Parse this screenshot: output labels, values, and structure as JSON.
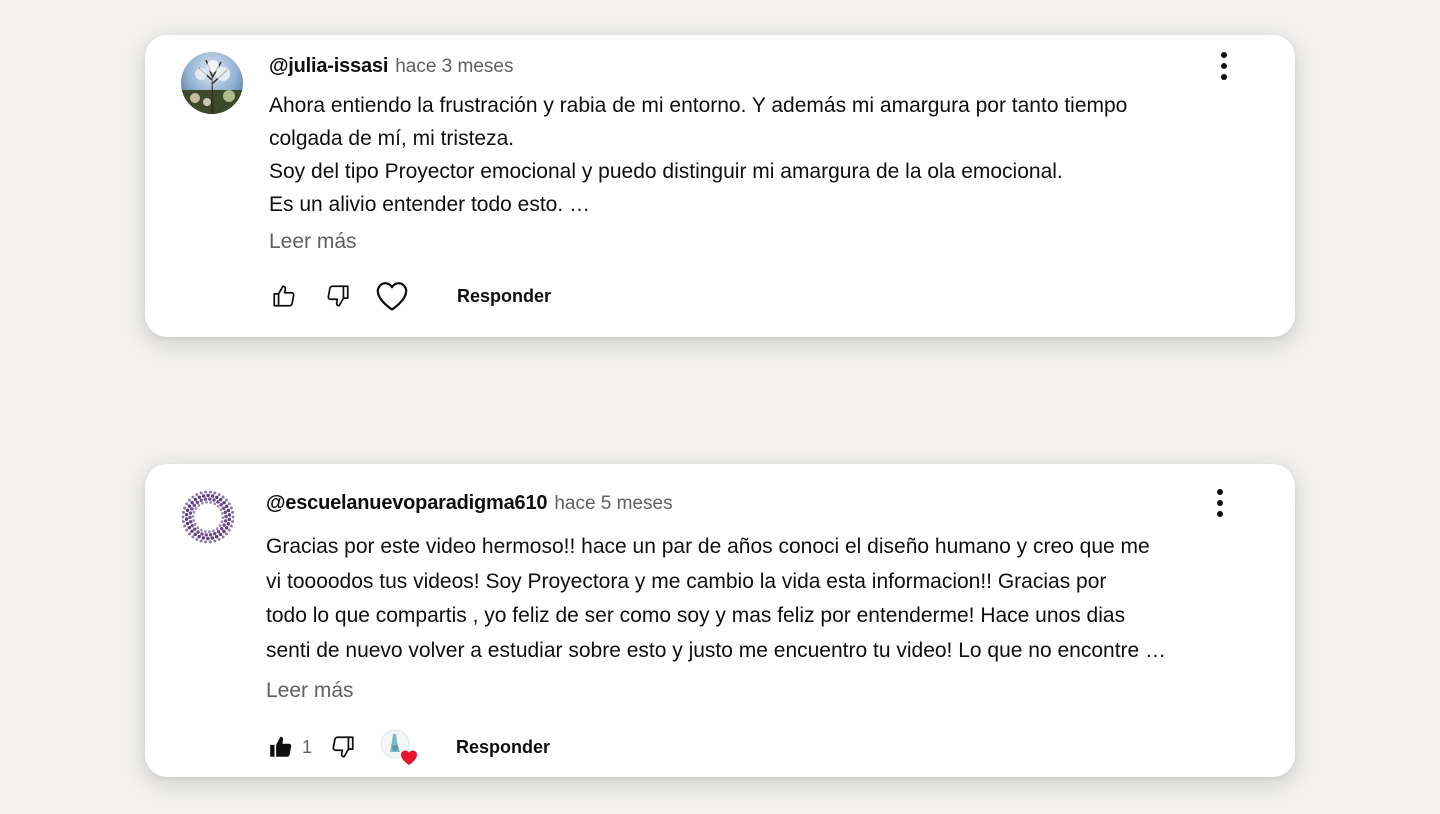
{
  "comments": [
    {
      "author": "@julia-issasi",
      "time": "hace 3 meses",
      "lines": [
        "Ahora entiendo la frustración y rabia de mi entorno. Y además mi amargura por tanto tiempo",
        "colgada de mí, mi tristeza.",
        "Soy del tipo Proyector emocional y puedo distinguir mi amargura de la ola emocional.",
        "Es un alivio entender todo esto. …"
      ],
      "read_more": "Leer más",
      "reply_label": "Responder",
      "avatar_icon": "profile-photo",
      "heart_icon": "heart-outline-icon"
    },
    {
      "author": "@escuelanuevoparadigma610",
      "time": "hace 5 meses",
      "lines": [
        "Gracias por este video hermoso!! hace un par de años conoci el diseño humano y creo que me",
        "vi toooodos tus videos! Soy Proyectora y me cambio la vida esta informacion!! Gracias por",
        "todo lo que compartis , yo feliz de ser como soy y mas feliz por entenderme!  Hace unos dias",
        "senti de nuevo volver a estudiar sobre esto y justo me encuentro tu video! Lo que no encontre …"
      ],
      "read_more": "Leer más",
      "like_count": "1",
      "reply_label": "Responder",
      "avatar_icon": "dotted-ring-logo",
      "heart_icon": "creator-heart-icon",
      "heart_color": "#e8132d"
    }
  ]
}
